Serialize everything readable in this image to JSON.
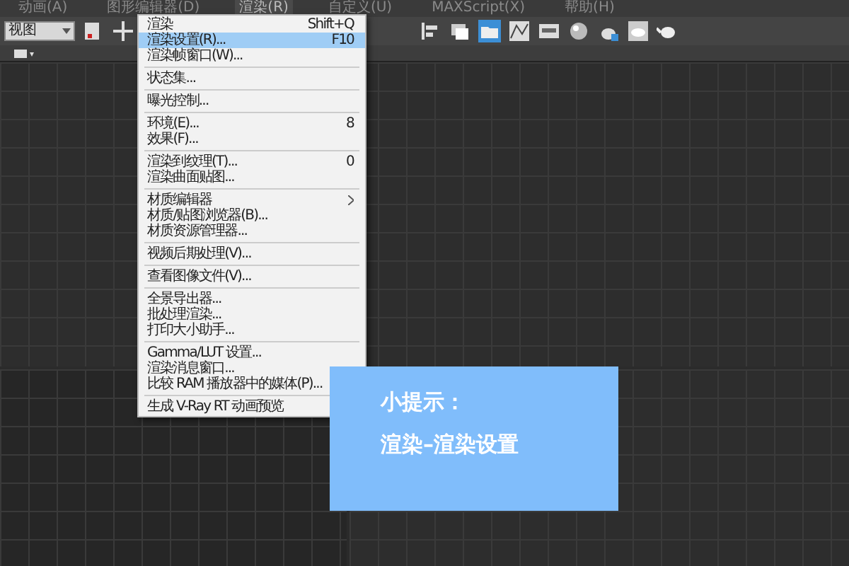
{
  "menu_bar": [
    {
      "label": "动画(A)",
      "selected": false
    },
    {
      "label": "图形编辑器(D)",
      "selected": false
    },
    {
      "label": "渲染(R)",
      "selected": true
    },
    {
      "label": "自定义(U)",
      "selected": false
    },
    {
      "label": "MAXScript(X)",
      "selected": false
    },
    {
      "label": "帮助(H)",
      "selected": false
    }
  ],
  "toolbar": {
    "view_dropdown": "视图"
  },
  "menu": {
    "groups": [
      [
        {
          "label": "渲染",
          "shortcut": "Shift+Q",
          "submenu": false,
          "selected": false
        },
        {
          "label": "渲染设置(R)...",
          "shortcut": "F10",
          "submenu": false,
          "selected": true
        },
        {
          "label": "渲染帧窗口(W)...",
          "submenu": false,
          "selected": false
        }
      ],
      [
        {
          "label": "状态集...",
          "submenu": false,
          "selected": false
        }
      ],
      [
        {
          "label": "曝光控制...",
          "submenu": false,
          "selected": false
        }
      ],
      [
        {
          "label": "环境(E)...",
          "shortcut": "8",
          "submenu": false,
          "selected": false
        },
        {
          "label": "效果(F)...",
          "submenu": false,
          "selected": false
        }
      ],
      [
        {
          "label": "渲染到纹理(T)...",
          "shortcut": "0",
          "submenu": false,
          "selected": false
        },
        {
          "label": "渲染曲面贴图...",
          "submenu": false,
          "selected": false
        }
      ],
      [
        {
          "label": "材质编辑器",
          "submenu": true,
          "selected": false
        },
        {
          "label": "材质/贴图浏览器(B)...",
          "submenu": false,
          "selected": false
        },
        {
          "label": "材质资源管理器...",
          "submenu": false,
          "selected": false
        }
      ],
      [
        {
          "label": "视频后期处理(V)...",
          "submenu": false,
          "selected": false
        }
      ],
      [
        {
          "label": "查看图像文件(V)...",
          "submenu": false,
          "selected": false
        }
      ],
      [
        {
          "label": "全景导出器...",
          "submenu": false,
          "selected": false
        },
        {
          "label": "批处理渲染...",
          "submenu": false,
          "selected": false
        },
        {
          "label": "打印大小助手...",
          "submenu": false,
          "selected": false
        }
      ],
      [
        {
          "label": "Gamma/LUT 设置...",
          "submenu": false,
          "selected": false
        },
        {
          "label": "渲染消息窗口...",
          "submenu": false,
          "selected": false
        },
        {
          "label": "比较 RAM 播放器中的媒体(P)...",
          "submenu": false,
          "selected": false
        }
      ],
      [
        {
          "label": "生成 V-Ray RT 动画预览",
          "submenu": false,
          "selected": false
        }
      ]
    ]
  },
  "tip": {
    "title": "小提示：",
    "text": "渲染–渲染设置"
  }
}
